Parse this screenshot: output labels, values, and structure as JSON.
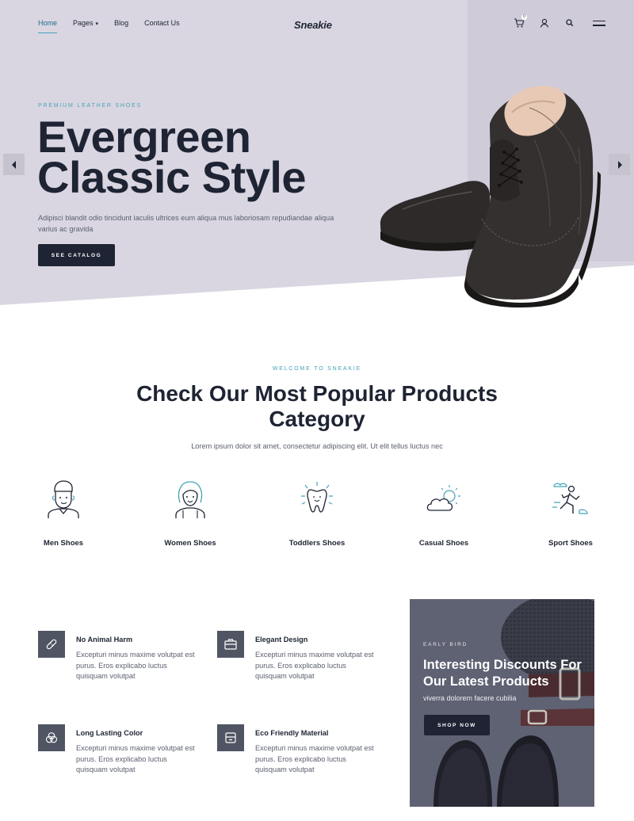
{
  "brand": {
    "logo": "Sneakie"
  },
  "nav": {
    "items": [
      {
        "label": "Home",
        "active": true
      },
      {
        "label": "Pages",
        "has_dropdown": true
      },
      {
        "label": "Blog"
      },
      {
        "label": "Contact Us"
      }
    ],
    "icons": [
      "cart-icon",
      "user-icon",
      "search-icon",
      "menu-icon"
    ],
    "cart_count": "0"
  },
  "hero": {
    "eyebrow": "PREMIUM LEATHER SHOES",
    "title_line1": "Evergreen",
    "title_line2": "Classic Style",
    "description": "Adipisci blandit odio tincidunt iaculis ultrices eum aliqua mus laboriosam repudiandae aliqua varius ac gravida",
    "button": "SEE CATALOG"
  },
  "categories_section": {
    "eyebrow": "WELCOME TO SNEAKIE",
    "title_line1": "Check Our Most Popular Products",
    "title_line2": "Category",
    "subtitle": "Lorem ipsum dolor sit amet, consectetur adipiscing elit. Ut elit tellus luctus nec",
    "items": [
      {
        "label": "Men Shoes",
        "icon": "man-icon"
      },
      {
        "label": "Women Shoes",
        "icon": "woman-icon"
      },
      {
        "label": "Toddlers Shoes",
        "icon": "tooth-icon"
      },
      {
        "label": "Casual Shoes",
        "icon": "sun-cloud-icon"
      },
      {
        "label": "Sport Shoes",
        "icon": "runner-icon"
      }
    ]
  },
  "features": [
    {
      "title": "No Animal Harm",
      "text": "Excepturi minus maxime volutpat est purus. Eros explicabo luctus quisquam volutpat",
      "icon": "bandage-icon"
    },
    {
      "title": "Elegant Design",
      "text": "Excepturi minus maxime volutpat est purus. Eros explicabo luctus quisquam volutpat",
      "icon": "briefcase-icon"
    },
    {
      "title": "Long Lasting Color",
      "text": "Excepturi minus maxime volutpat est purus. Eros explicabo luctus quisquam volutpat",
      "icon": "color-circles-icon"
    },
    {
      "title": "Eco Friendly Material",
      "text": "Excepturi minus maxime volutpat est purus. Eros explicabo luctus quisquam volutpat",
      "icon": "material-icon"
    }
  ],
  "promo": {
    "eyebrow": "EARLY BIRD",
    "title_line1": "Interesting Discounts For",
    "title_line2": "Our Latest Products",
    "subtitle": "viverra dolorem facere cubilia",
    "button": "SHOP NOW"
  },
  "colors": {
    "dark": "#1e2433",
    "accent": "#46a3b8",
    "hero_bg": "#d9d6e1",
    "icon_box": "#505564",
    "body_text": "#5a5f6e"
  }
}
